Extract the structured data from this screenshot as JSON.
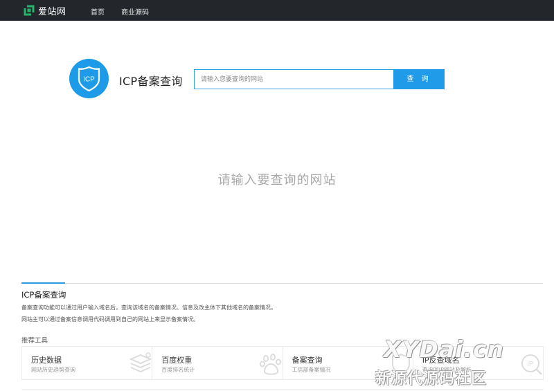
{
  "nav": {
    "logo_text": "爱站网",
    "links": [
      "首页",
      "商业源码"
    ]
  },
  "search": {
    "title": "ICP备案查询",
    "badge_text": "ICP",
    "placeholder": "请输入您要查询的网站",
    "button_label": "查 询"
  },
  "main": {
    "empty_message": "请输入要查询的网站"
  },
  "info": {
    "title": "ICP备案查询",
    "descriptions": [
      "备案查询功能可以通过用户输入域名后，查询该域名的备案情况、信息及改主体下其他域名的备案情况。",
      "网站主可以通过备案信息调用代码调用到自己的网站上来显示备案情况。"
    ],
    "tools_heading": "推荐工具",
    "tools": [
      {
        "name": "历史数据",
        "desc": "网站历史趋势查询",
        "icon": "layers-icon"
      },
      {
        "name": "百度权重",
        "desc": "百度排名统计",
        "icon": "baidu-paw-icon"
      },
      {
        "name": "备案查询",
        "desc": "工信部备案情况",
        "icon": "shield-icon"
      },
      {
        "name": "IP反查域名",
        "desc": "查询同IP网站及解析",
        "icon": "ip-search-icon"
      }
    ]
  },
  "watermark": {
    "line1": "XYDai.cn",
    "line2": "新源代源码社区"
  },
  "colors": {
    "nav_bg": "#23262b",
    "accent": "#1f9bea",
    "logo_green": "#27b36b"
  }
}
